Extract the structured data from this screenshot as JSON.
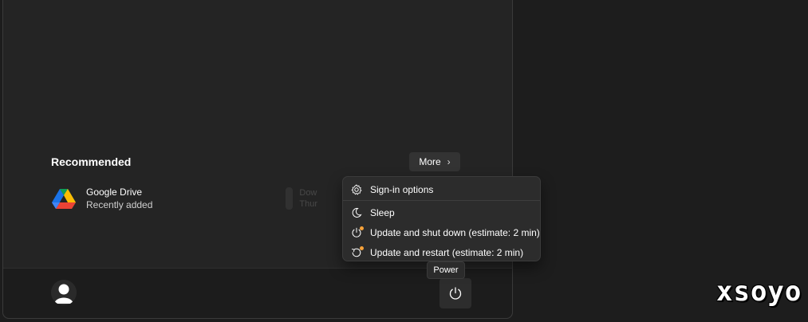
{
  "recommended": {
    "title": "Recommended",
    "more_label": "More",
    "items": [
      {
        "name": "Google Drive",
        "subtitle": "Recently added",
        "icon": "google-drive-icon"
      }
    ],
    "obscured_item": {
      "name_fragment": "Dow",
      "subtitle_fragment": "Thur"
    }
  },
  "power_menu": {
    "items": [
      {
        "label": "Sign-in options",
        "icon": "gear-icon"
      },
      {
        "label": "Sleep",
        "icon": "moon-icon"
      },
      {
        "label": "Update and shut down (estimate: 2 min)",
        "icon": "power-update-icon"
      },
      {
        "label": "Update and restart (estimate: 2 min)",
        "icon": "restart-update-icon"
      }
    ],
    "update_dot_color": "#f7a23a"
  },
  "tooltip": "Power",
  "user": {
    "avatar_icon": "user-avatar-icon"
  },
  "power_button": {
    "icon": "power-icon"
  },
  "watermark": "xsoyo"
}
